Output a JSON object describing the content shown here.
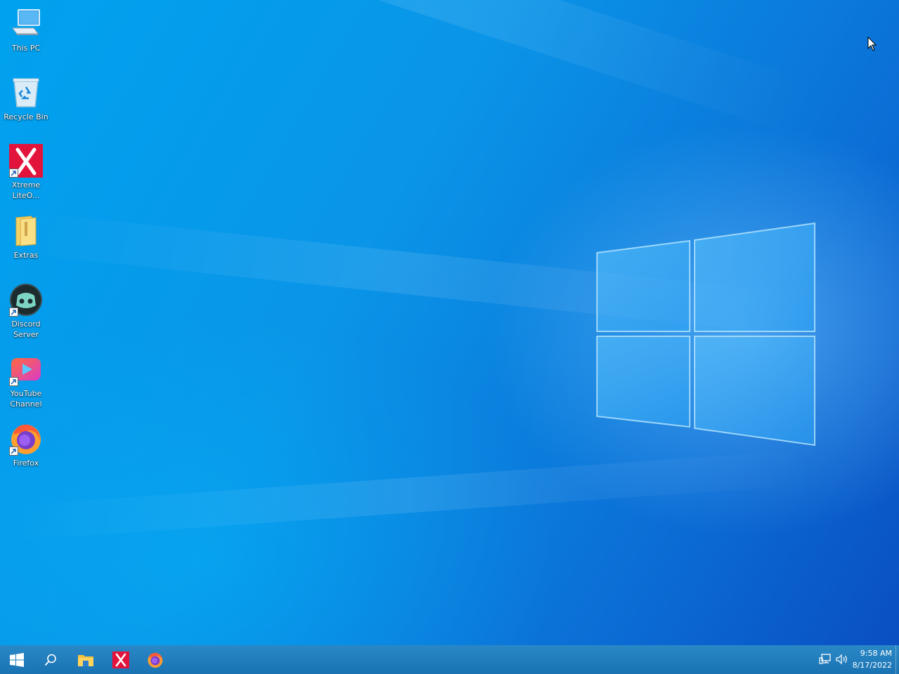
{
  "desktop": {
    "icons": [
      {
        "label": "This PC",
        "icon": "computer-icon",
        "shortcut": false
      },
      {
        "label": "Recycle Bin",
        "icon": "recycle-bin-icon",
        "shortcut": false
      },
      {
        "label": "Xtreme\nLiteO...",
        "icon": "xtreme-x-icon",
        "shortcut": true
      },
      {
        "label": "Extras",
        "icon": "folder-icon",
        "shortcut": false
      },
      {
        "label": "Discord\nServer",
        "icon": "discord-icon",
        "shortcut": true
      },
      {
        "label": "YouTube\nChannel",
        "icon": "youtube-icon",
        "shortcut": true
      },
      {
        "label": "Firefox",
        "icon": "firefox-icon",
        "shortcut": true
      }
    ]
  },
  "taskbar": {
    "pinned": [
      "start-windows-icon",
      "search-icon",
      "file-explorer-icon",
      "xtreme-x-icon",
      "firefox-icon"
    ],
    "tray": [
      "network-icon",
      "volume-icon"
    ],
    "clock": {
      "time": "9:58 AM",
      "date": "8/17/2022"
    }
  },
  "colors": {
    "desktop_blue": "#0a95e8",
    "taskbar": "#1f7fc0",
    "xtreme_red": "#e3143c"
  }
}
